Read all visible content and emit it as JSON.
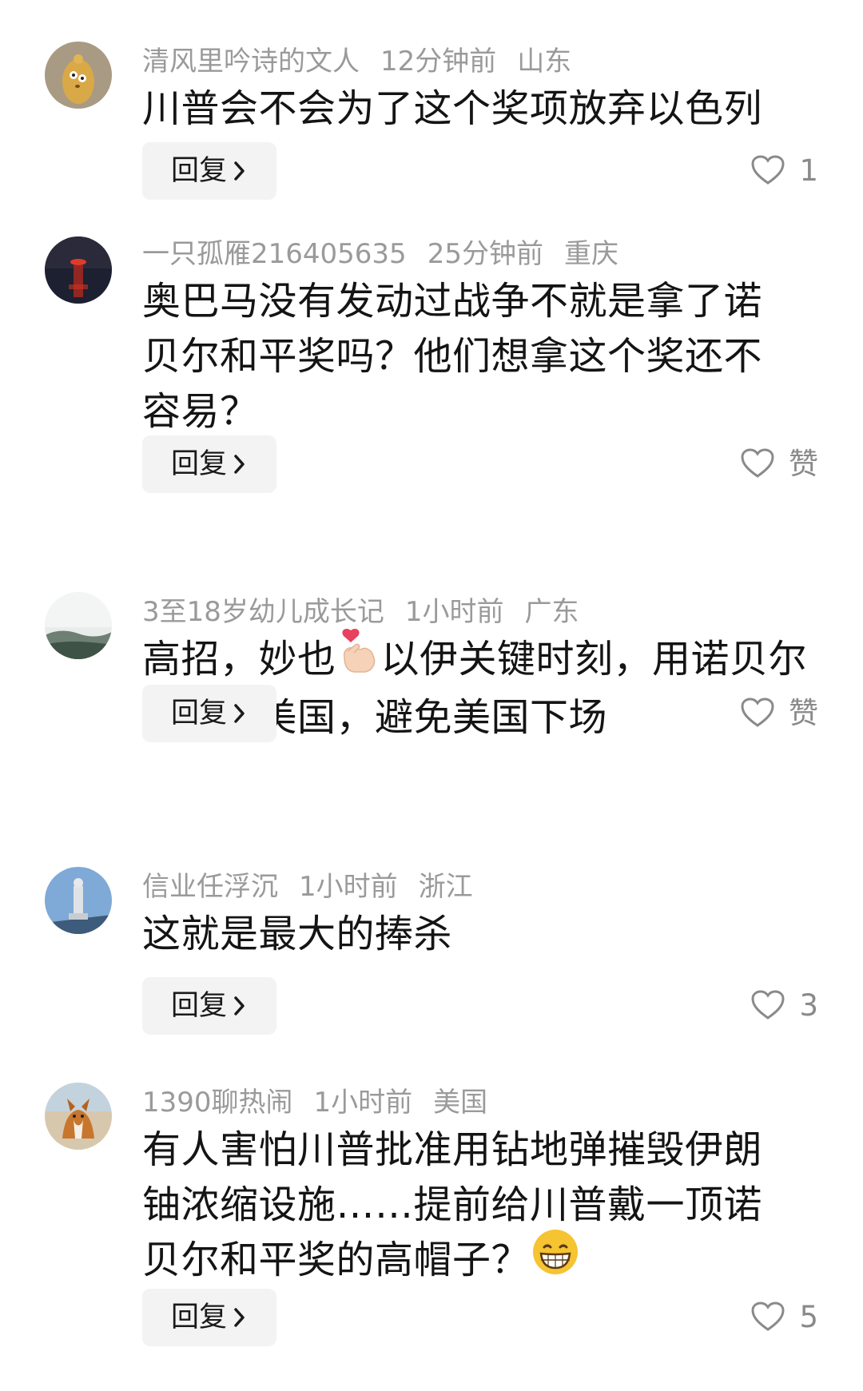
{
  "comments": [
    {
      "username": "清风里吟诗的文人",
      "time": "12分钟前",
      "location": "山东",
      "text": "川普会不会为了这个奖项放弃以色列",
      "reply_label": "回复",
      "likes": "1",
      "avatar_icon": "cartoon-character-avatar"
    },
    {
      "username": "一只孤雁216405635",
      "time": "25分钟前",
      "location": "重庆",
      "text": "奥巴马没有发动过战争不就是拿了诺贝尔和平奖吗？他们想拿这个奖还不容易？",
      "reply_label": "回复",
      "likes": "赞",
      "avatar_icon": "sunset-water-avatar"
    },
    {
      "username": "3至18岁幼儿成长记",
      "time": "1小时前",
      "location": "广东",
      "text_before_emoji": "高招，妙也",
      "emoji_icon": "finger-heart-emoji",
      "text_after_emoji": "以伊关键时刻，用诺贝尔奖拖住美国，避免美国下场",
      "reply_label": "回复",
      "likes": "赞",
      "avatar_icon": "misty-landscape-avatar"
    },
    {
      "username": "信业任浮沉",
      "time": "1小时前",
      "location": "浙江",
      "text": "这就是最大的捧杀",
      "reply_label": "回复",
      "likes": "3",
      "avatar_icon": "statue-sky-avatar"
    },
    {
      "username": "1390聊热闹",
      "time": "1小时前",
      "location": "美国",
      "text_before_emoji": "有人害怕川普批准用钻地弹摧毁伊朗铀浓缩设施……提前给川普戴一顶诺贝尔和平奖的高帽子？",
      "emoji_icon": "grinning-face-emoji",
      "reply_label": "回复",
      "likes": "5",
      "avatar_icon": "corgi-dog-avatar"
    }
  ]
}
